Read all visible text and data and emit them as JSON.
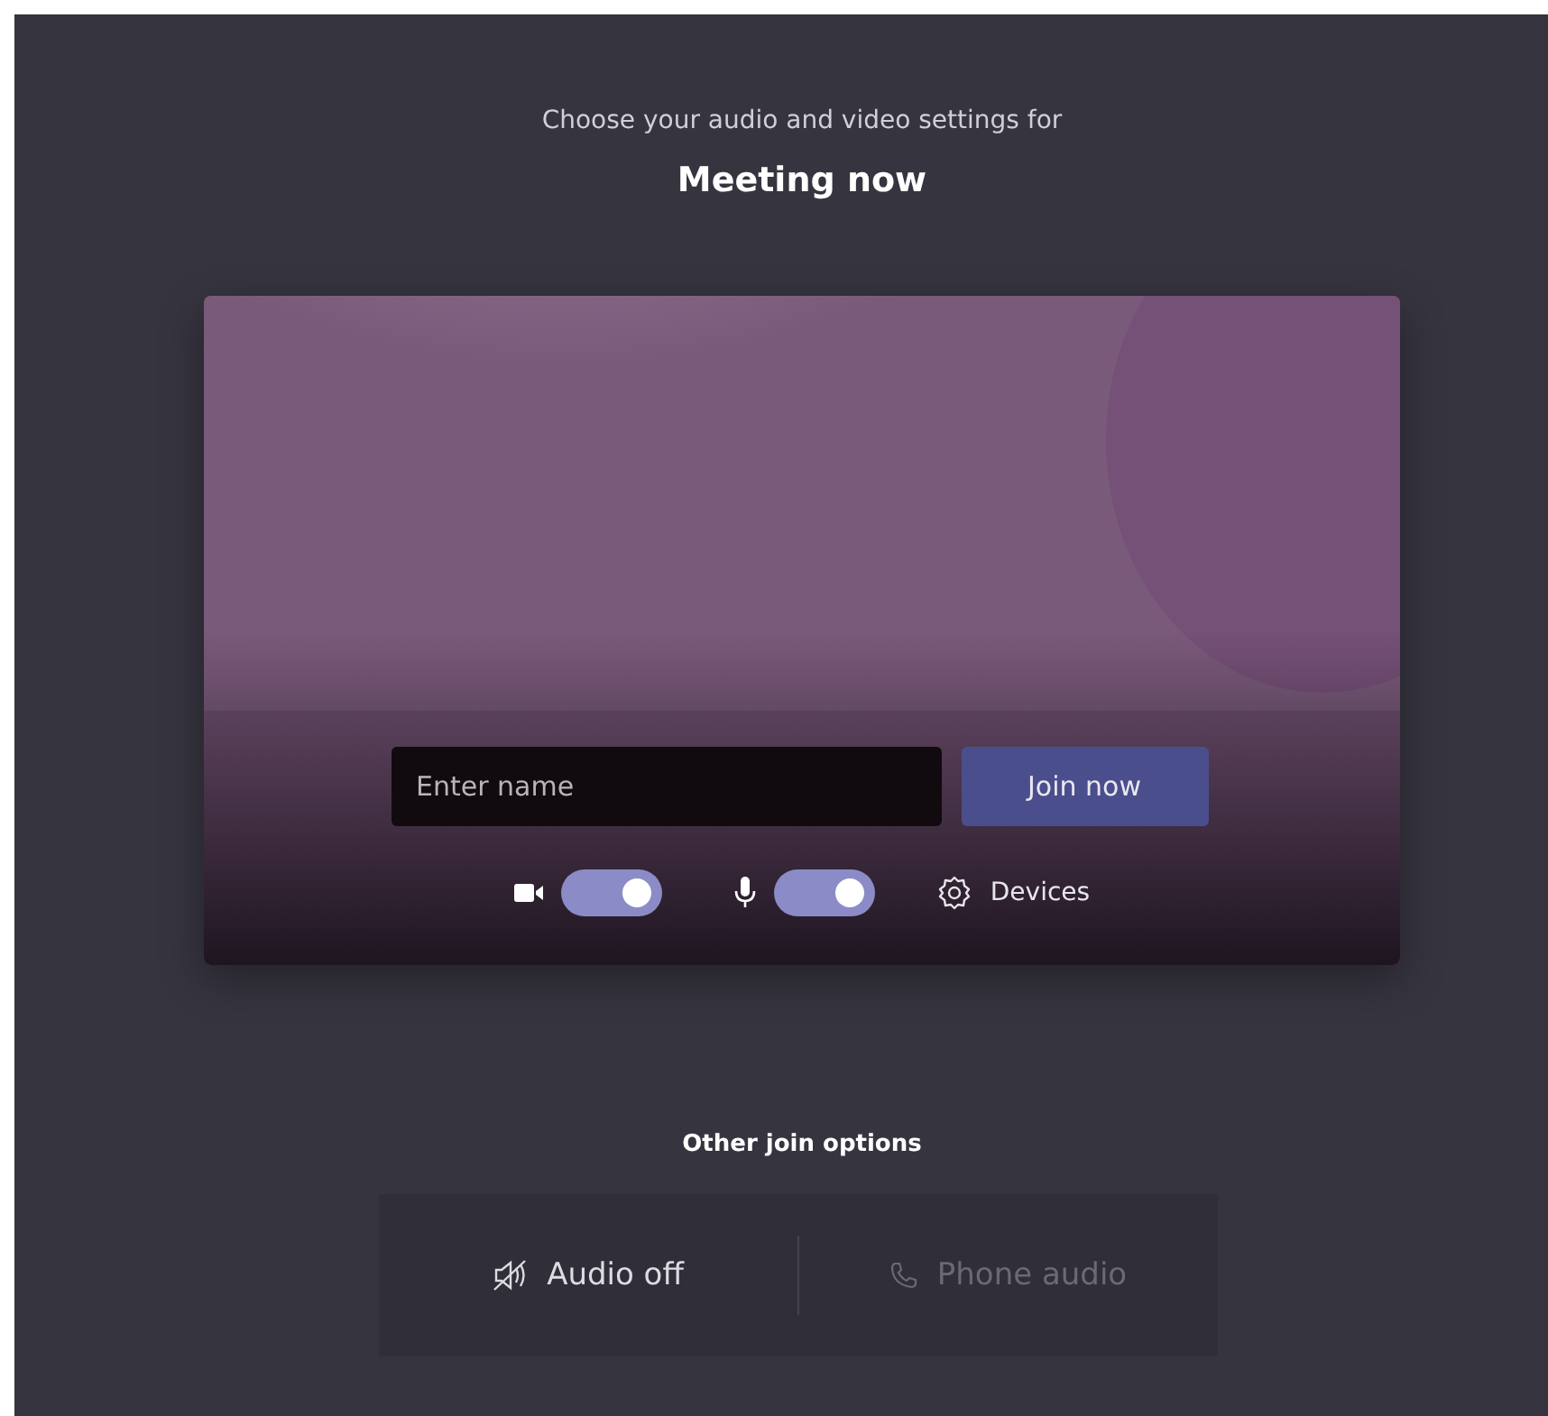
{
  "prompt": "Choose your audio and video settings for",
  "meeting_title": "Meeting now",
  "name_field": {
    "placeholder": "Enter name"
  },
  "join_button": "Join now",
  "toggles": [
    {
      "kind": "camera",
      "on": true
    },
    {
      "kind": "microphone",
      "on": true
    }
  ],
  "devices_button": "Devices",
  "other_options": {
    "heading": "Other join options",
    "options": [
      {
        "kind": "audio-off",
        "label": "Audio off",
        "disabled": false
      },
      {
        "kind": "phone",
        "label": "Phone audio",
        "disabled": true
      }
    ]
  }
}
